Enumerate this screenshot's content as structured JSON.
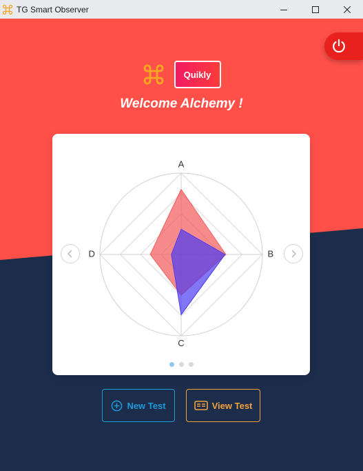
{
  "window": {
    "title": "TG Smart Observer",
    "controls": [
      "minimize",
      "maximize",
      "close"
    ]
  },
  "brand": {
    "icon": "command-icon",
    "badge_label": "Quikly"
  },
  "welcome_text": "Welcome Alchemy !",
  "carousel": {
    "page_count": 3,
    "active_page": 1
  },
  "chart_data": {
    "type": "radar",
    "axes": [
      "A",
      "B",
      "C",
      "D"
    ],
    "rings": 4,
    "series": [
      {
        "values": [
          0.8,
          0.55,
          0.5,
          0.38
        ],
        "color": "#f45a5a"
      },
      {
        "values": [
          0.31,
          0.54,
          0.74,
          0.12
        ],
        "color": "#4a3cf2"
      }
    ]
  },
  "actions": {
    "new_test_label": "New Test",
    "view_test_label": "View Test"
  },
  "colors": {
    "top_background": "#fe5049",
    "bottom_background": "#1c2d4b",
    "power_button": "#e8211f",
    "new_test_accent": "#1d9bd8",
    "view_test_accent": "#f2a23a"
  }
}
